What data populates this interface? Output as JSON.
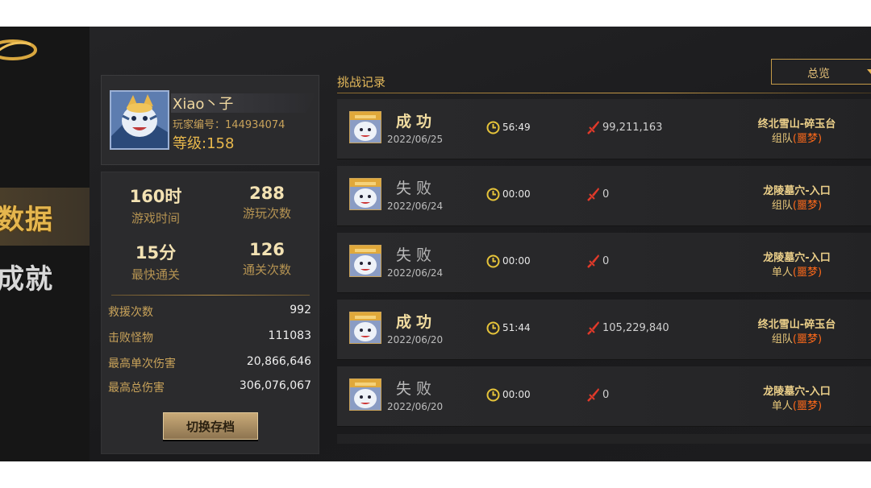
{
  "nav": {
    "items": [
      {
        "label": "数据",
        "active": true
      },
      {
        "label": "成就",
        "active": false
      }
    ]
  },
  "profile": {
    "name": "Xiao丶子",
    "player_id": "玩家编号：144934074",
    "level": "等级:158"
  },
  "stats": {
    "play_time": {
      "value": "160时",
      "label": "游戏时间"
    },
    "play_count": {
      "value": "288",
      "label": "游玩次数"
    },
    "fastest": {
      "value": "15分",
      "label": "最快通关"
    },
    "clear_count": {
      "value": "126",
      "label": "通关次数"
    },
    "rows": [
      {
        "key": "救援次数",
        "value": "992"
      },
      {
        "key": "击败怪物",
        "value": "111083"
      },
      {
        "key": "最高单次伤害",
        "value": "20,866,646"
      },
      {
        "key": "最高总伤害",
        "value": "306,076,067"
      }
    ],
    "switch_button": "切换存档"
  },
  "records": {
    "title": "挑战记录",
    "filter": "总览",
    "items": [
      {
        "result": "成功",
        "win": true,
        "date": "2022/06/25",
        "time": "56:49",
        "damage": "99,211,163",
        "location": "终北雪山-碎玉台",
        "mode": "组队",
        "difficulty": "(噩梦)"
      },
      {
        "result": "失败",
        "win": false,
        "date": "2022/06/24",
        "time": "00:00",
        "damage": "0",
        "location": "龙陵墓穴-入口",
        "mode": "组队",
        "difficulty": "(噩梦)"
      },
      {
        "result": "失败",
        "win": false,
        "date": "2022/06/24",
        "time": "00:00",
        "damage": "0",
        "location": "龙陵墓穴-入口",
        "mode": "单人",
        "difficulty": "(噩梦)"
      },
      {
        "result": "成功",
        "win": true,
        "date": "2022/06/20",
        "time": "51:44",
        "damage": "105,229,840",
        "location": "终北雪山-碎玉台",
        "mode": "组队",
        "difficulty": "(噩梦)"
      },
      {
        "result": "失败",
        "win": false,
        "date": "2022/06/20",
        "time": "00:00",
        "damage": "0",
        "location": "龙陵墓穴-入口",
        "mode": "单人",
        "difficulty": "(噩梦)"
      }
    ]
  },
  "colors": {
    "accent_gold": "#e3b85a",
    "difficulty_orange": "#ff6a1a",
    "damage_red": "#e23a2a"
  }
}
